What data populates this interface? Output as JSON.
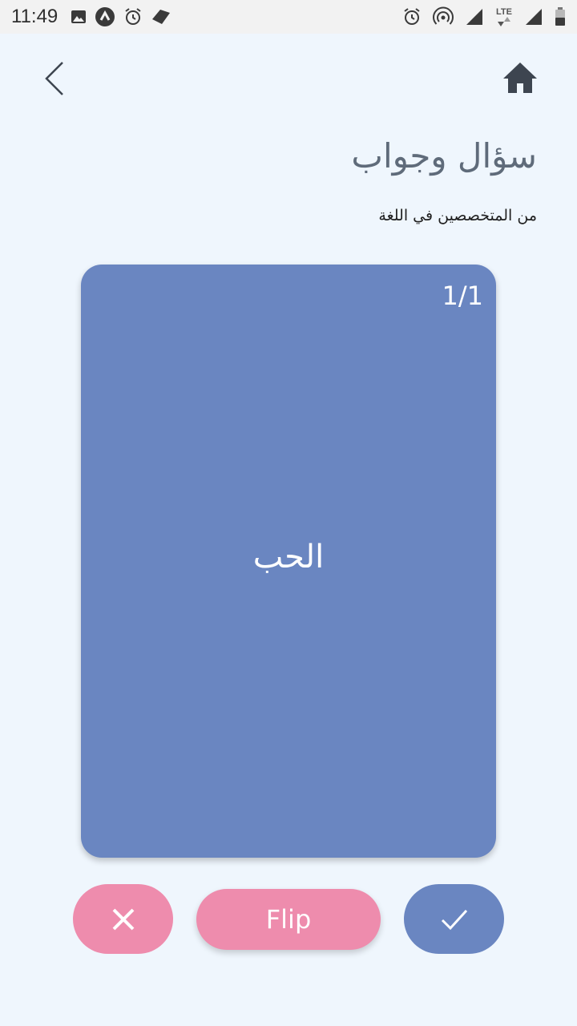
{
  "status_bar": {
    "time": "11:49",
    "network_label": "LTE"
  },
  "header": {
    "back_icon": "chevron-left-icon",
    "home_icon": "home-icon",
    "title": "سؤال وجواب",
    "subtitle": "من المتخصصين في اللغة"
  },
  "card": {
    "counter": "1/1",
    "word": "الحب",
    "color": "#6a86c1"
  },
  "actions": {
    "wrong_icon": "close-icon",
    "flip_label": "Flip",
    "right_icon": "check-icon",
    "pink": "#ee8cad",
    "blue": "#6a86c1"
  }
}
